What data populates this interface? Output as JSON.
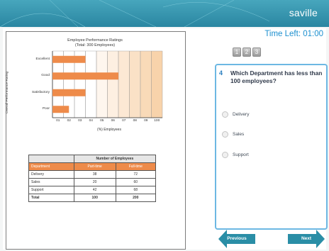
{
  "brand": "saville",
  "timer": "Time Left: 01:00",
  "question_numbers": [
    "1",
    "2",
    "3"
  ],
  "question": {
    "number": "4",
    "text": "Which Department has less than 100 employees?",
    "options": [
      "Delivery",
      "Sales",
      "Support"
    ]
  },
  "nav": {
    "previous": "Previous",
    "next": "Next"
  },
  "chart_data": {
    "type": "bar",
    "orientation": "horizontal",
    "title": "Employee Performance Ratings",
    "subtitle": "(Total: 300 Employees)",
    "ylabel": "Overall Performance Rating",
    "xlabel": "(%) Employees",
    "categories": [
      "Excellent",
      "Good",
      "Satisfactory",
      "Poor"
    ],
    "values": [
      3,
      6,
      3,
      1.5
    ],
    "x_ticks": [
      "01",
      "02",
      "03",
      "04",
      "05",
      "06",
      "07",
      "08",
      "09",
      "100"
    ],
    "bar_color": "#ee8b4a",
    "shaded_columns_color": "#f6c48f"
  },
  "table": {
    "header_top": "Number of Employees",
    "header_labels": [
      "Department",
      "Part-time",
      "Full-time"
    ],
    "rows": [
      [
        "Delivery",
        "38",
        "72"
      ],
      [
        "Sales",
        "20",
        "60"
      ],
      [
        "Support",
        "42",
        "68"
      ]
    ],
    "total": [
      "Total",
      "100",
      "200"
    ]
  },
  "colors": {
    "accent": "#2a86a1",
    "timer": "#1b8fcf",
    "option_border": "#6db8e3"
  }
}
